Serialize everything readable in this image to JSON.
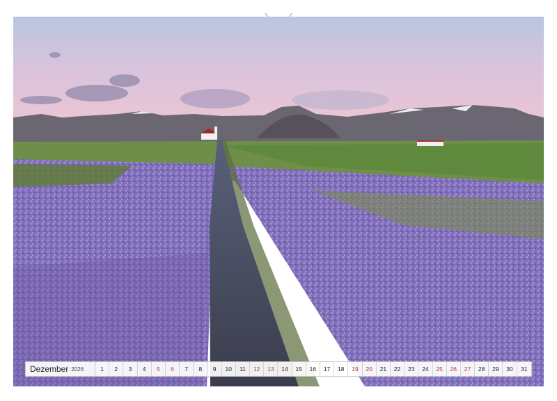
{
  "calendar": {
    "month": "Dezember",
    "year": "2026",
    "days": [
      {
        "n": "1",
        "we": false
      },
      {
        "n": "2",
        "we": false
      },
      {
        "n": "3",
        "we": false
      },
      {
        "n": "4",
        "we": false
      },
      {
        "n": "5",
        "we": true
      },
      {
        "n": "6",
        "we": true
      },
      {
        "n": "7",
        "we": false
      },
      {
        "n": "8",
        "we": false
      },
      {
        "n": "9",
        "we": false
      },
      {
        "n": "10",
        "we": false
      },
      {
        "n": "11",
        "we": false
      },
      {
        "n": "12",
        "we": true
      },
      {
        "n": "13",
        "we": true
      },
      {
        "n": "14",
        "we": false
      },
      {
        "n": "15",
        "we": false
      },
      {
        "n": "16",
        "we": false
      },
      {
        "n": "17",
        "we": false
      },
      {
        "n": "18",
        "we": false
      },
      {
        "n": "19",
        "we": true
      },
      {
        "n": "20",
        "we": true
      },
      {
        "n": "21",
        "we": false
      },
      {
        "n": "22",
        "we": false
      },
      {
        "n": "23",
        "we": false
      },
      {
        "n": "24",
        "we": false
      },
      {
        "n": "25",
        "we": true
      },
      {
        "n": "26",
        "we": true
      },
      {
        "n": "27",
        "we": true
      },
      {
        "n": "28",
        "we": false
      },
      {
        "n": "29",
        "we": false
      },
      {
        "n": "30",
        "we": false
      },
      {
        "n": "31",
        "we": false
      }
    ],
    "weekend_color": "#c0392b"
  },
  "binding": {
    "hole_color": "#9a9a9a"
  }
}
